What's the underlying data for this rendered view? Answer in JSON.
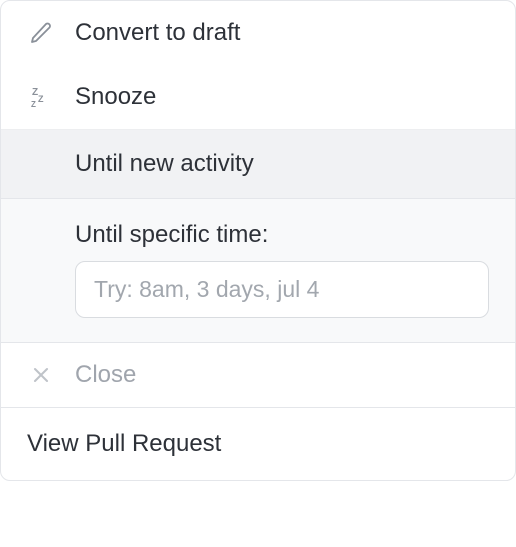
{
  "menu": {
    "convert_draft": {
      "label": "Convert to draft",
      "icon": "pencil-icon"
    },
    "snooze": {
      "label": "Snooze",
      "icon": "snooze-icon"
    },
    "close": {
      "label": "Close",
      "icon": "x-icon"
    },
    "view_pr": {
      "label": "View Pull Request"
    }
  },
  "snooze_submenu": {
    "until_activity": "Until new activity",
    "until_time_label": "Until specific time:",
    "time_input_placeholder": "Try: 8am, 3 days, jul 4"
  }
}
